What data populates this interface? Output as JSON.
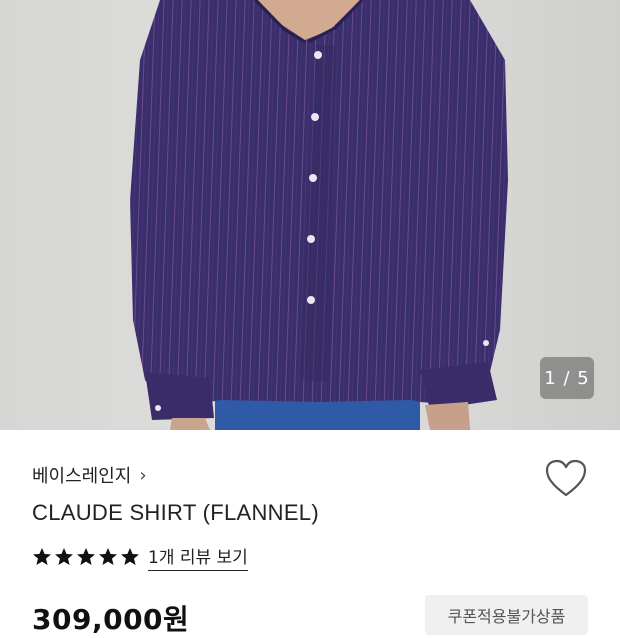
{
  "gallery": {
    "counter": "1 / 5",
    "current": 1,
    "total": 5
  },
  "product": {
    "brand": "베이스레인지",
    "brand_chevron": "›",
    "title": "CLAUDE SHIRT (FLANNEL)",
    "rating_stars": 5,
    "review_link": "1개 리뷰 보기",
    "price": "309,000원",
    "coupon_badge": "쿠폰적용불가상품"
  },
  "icons": {
    "wishlist": "heart-outline-icon",
    "star": "star-filled-icon"
  },
  "colors": {
    "shirt": "#3b2f6e",
    "text": "#222222",
    "badge_bg": "#f0f0f0"
  }
}
